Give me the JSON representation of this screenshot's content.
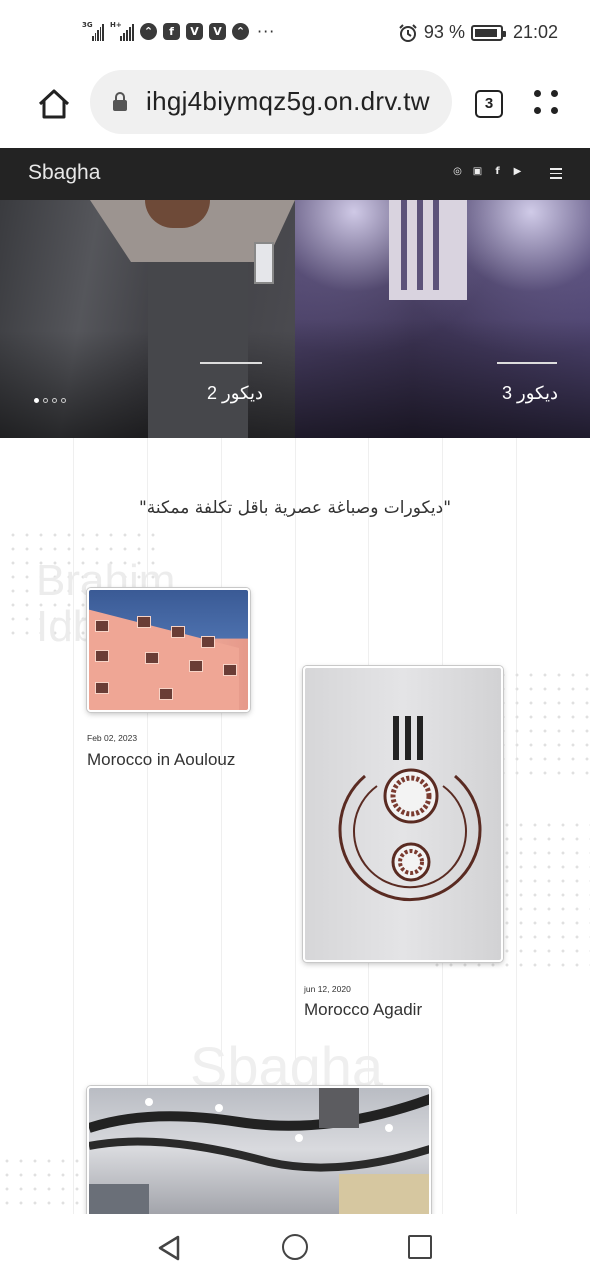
{
  "status_bar": {
    "signal_1_label": "3G",
    "signal_2_label": "H+",
    "app_icons": [
      "browser-icon",
      "facebook-icon",
      "vivaldi-icon",
      "vivaldi-icon",
      "browser-icon"
    ],
    "more": "···",
    "battery_percent": "93 %",
    "battery_level": 0.93,
    "time": "21:02"
  },
  "browser": {
    "url": "ihgj4biymqz5g.on.drv.tw",
    "tab_count": "3"
  },
  "site": {
    "brand": "Sbagha",
    "social_icons": [
      "whatsapp-icon",
      "instagram-icon",
      "facebook-icon",
      "youtube-icon"
    ]
  },
  "slider": {
    "slides": [
      {
        "caption": "ديكور 2"
      },
      {
        "caption": "ديكور 3"
      }
    ],
    "dot_count": 4,
    "active_dot": 0
  },
  "content": {
    "tagline": "\"ديكورات وصباغة عصرية باقل تكلفة ممكنة\"",
    "watermark_1_line1": "Brahim",
    "watermark_1_line2": "Idb",
    "watermark_2": "Sbagha",
    "posts": [
      {
        "date": "Feb 02, 2023",
        "title": "Morocco in Aoulouz"
      },
      {
        "date": "jun 12, 2020",
        "title": "Morocco Agadir"
      }
    ]
  },
  "colors": {
    "header_bg": "#232323",
    "url_pill_bg": "#f0f0f0"
  }
}
